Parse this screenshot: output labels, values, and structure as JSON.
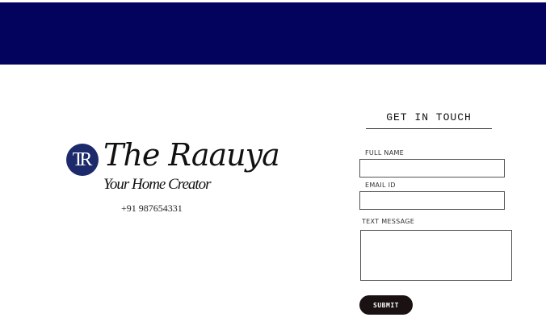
{
  "header": {
    "banner_color": "#03035e"
  },
  "logo": {
    "monogram": "TR",
    "brand_name": "The Raauya",
    "tagline": "Your Home Creator"
  },
  "contact": {
    "phone": "+91 987654331"
  },
  "form": {
    "title": "GET IN TOUCH",
    "full_name_label": "FULL NAME",
    "full_name_value": "",
    "email_label": "EMAIL ID",
    "email_value": "",
    "message_label": "TEXT MESSAGE",
    "message_value": "",
    "submit_label": "SUBMIT"
  },
  "colors": {
    "accent": "#03035e",
    "button": "#1a1212",
    "monogram_bg": "#1c2a6b"
  }
}
